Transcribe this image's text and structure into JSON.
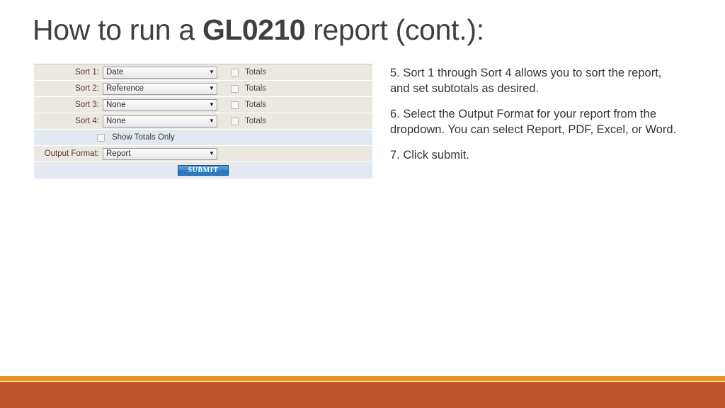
{
  "slide": {
    "title_part1": "How to run a ",
    "title_code": "GL0210",
    "title_part2": " report (cont.):"
  },
  "form": {
    "rows": [
      {
        "label": "Sort 1:",
        "value": "Date",
        "totals_label": "Totals"
      },
      {
        "label": "Sort 2:",
        "value": "Reference",
        "totals_label": "Totals"
      },
      {
        "label": "Sort 3:",
        "value": "None",
        "totals_label": "Totals"
      },
      {
        "label": "Sort 4:",
        "value": "None",
        "totals_label": "Totals"
      }
    ],
    "show_totals_only_label": "Show Totals Only",
    "output_format_label": "Output Format:",
    "output_format_value": "Report",
    "submit_label": "SUBMIT",
    "caret_glyph": "▼"
  },
  "notes": {
    "step5": "5. Sort 1 through Sort 4 allows you to sort the report, and set subtotals as desired.",
    "step6": "6. Select the Output Format for your report from the dropdown.  You can select Report, PDF, Excel, or Word.",
    "step7": "7. Click submit."
  },
  "colors": {
    "bar_light": "#E8922A",
    "bar_dark": "#C0562A",
    "title": "#3F3F3F",
    "row_beige": "#EAE8E0",
    "row_blue": "#E2E9F0",
    "submit_blue": "#2F7CBD"
  }
}
